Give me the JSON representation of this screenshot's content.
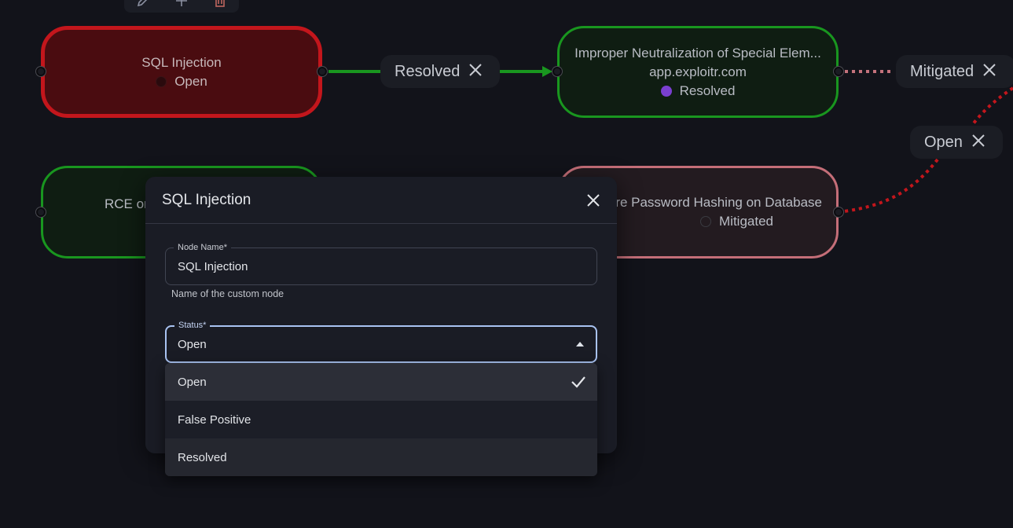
{
  "toolbar": {
    "icons": [
      "edit-icon",
      "add-icon",
      "delete-icon"
    ],
    "delete_color": "#c0665f"
  },
  "nodes": {
    "sql_injection": {
      "title": "SQL Injection",
      "status": "Open"
    },
    "improper_neutralization": {
      "title": "Improper Neutralization of Special Elem...",
      "host": "app.exploitr.com",
      "status": "Resolved"
    },
    "rce": {
      "title": "RCE on"
    },
    "password_hashing": {
      "title": "re Password Hashing on Database",
      "status": "Mitigated"
    }
  },
  "edges": {
    "resolved": {
      "label": "Resolved"
    },
    "mitigated": {
      "label": "Mitigated"
    },
    "open": {
      "label": "Open"
    }
  },
  "modal": {
    "title": "SQL Injection",
    "node_name": {
      "label": "Node Name*",
      "value": "SQL Injection",
      "helper": "Name of the custom node"
    },
    "status": {
      "label": "Status*",
      "value": "Open",
      "options": [
        "Open",
        "False Positive",
        "Resolved"
      ],
      "selected": "Open"
    }
  },
  "colors": {
    "open_node_border": "#c3161c",
    "resolved_node_border": "#19961f",
    "mitigated_node_border": "#c46e78",
    "resolved_edge": "#19961f",
    "mitigated_edge": "#c4727c",
    "open_edge": "#c3161c",
    "resolved_dot": "#7a3fd0",
    "focus_border": "#a9c3f2"
  }
}
